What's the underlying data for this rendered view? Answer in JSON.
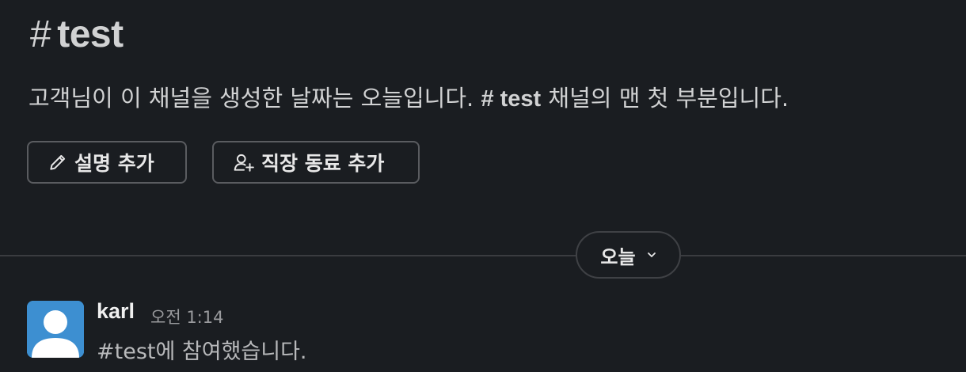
{
  "channel": {
    "hash_symbol": "#",
    "name": "test"
  },
  "intro": {
    "text_before": "고객님이 이 채널을 생성한 날짜는 오늘입니다. ",
    "channel_ref": "# test",
    "text_after": " 채널의 맨 첫 부분입니다."
  },
  "actions": {
    "add_description": {
      "label": "설명 추가",
      "icon": "pencil-icon"
    },
    "add_coworkers": {
      "label": "직장 동료 추가",
      "icon": "add-user-icon"
    }
  },
  "divider": {
    "date_label": "오늘",
    "icon": "chevron-down-icon"
  },
  "message": {
    "author": "karl",
    "time": "오전 1:14",
    "body": "#test에 참여했습니다.",
    "avatar_color": "#3d8fd1"
  }
}
